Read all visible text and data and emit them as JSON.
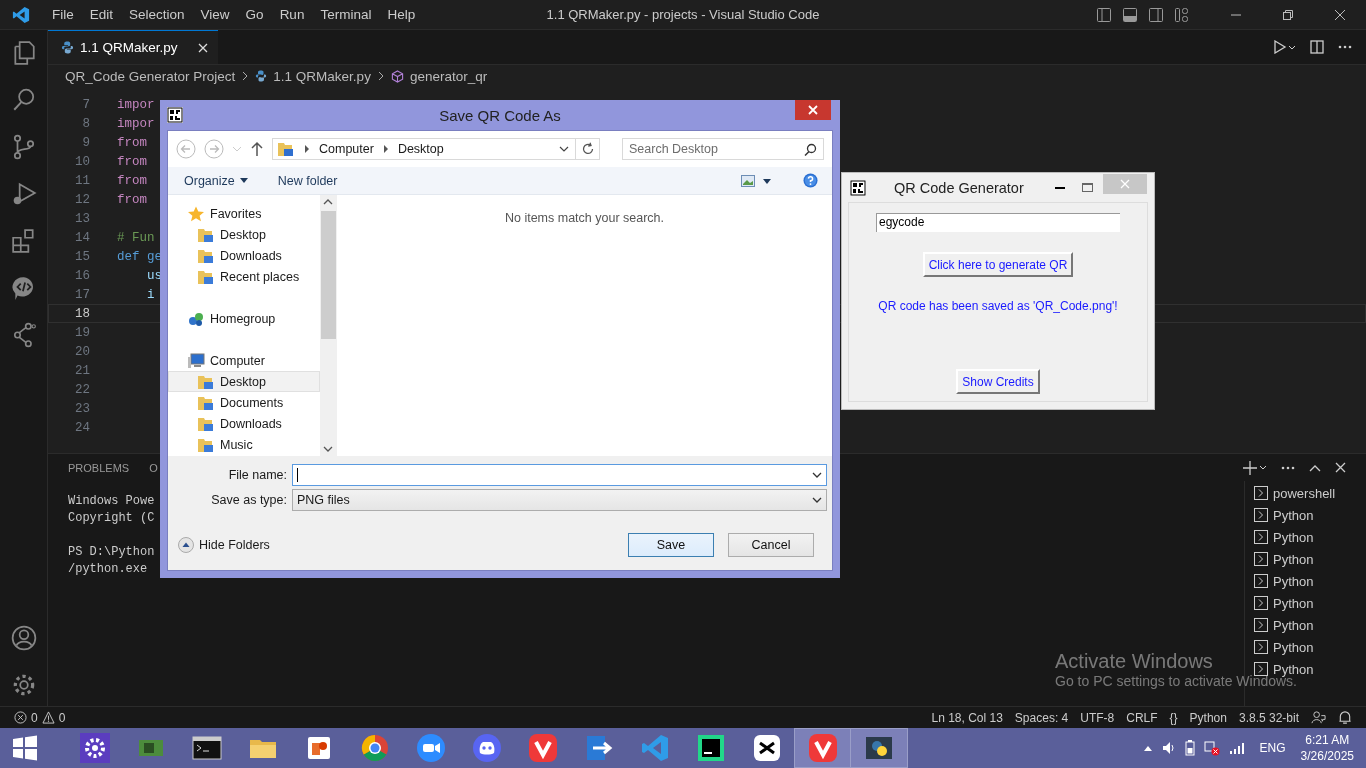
{
  "window": {
    "title": "1.1 QRMaker.py - projects - Visual Studio Code"
  },
  "menu": [
    "File",
    "Edit",
    "Selection",
    "View",
    "Go",
    "Run",
    "Terminal",
    "Help"
  ],
  "editor_tab": {
    "label": "1.1 QRMaker.py"
  },
  "breadcrumb": [
    "QR_Code Generator Project",
    "1.1 QRMaker.py",
    "generator_qr"
  ],
  "code_lines": [
    {
      "number": "7",
      "text": "impor",
      "kind": "keyword",
      "current": false
    },
    {
      "number": "8",
      "text": "impor",
      "kind": "keyword",
      "current": false
    },
    {
      "number": "9",
      "text": "from",
      "kind": "keyword",
      "current": false
    },
    {
      "number": "10",
      "text": "from",
      "kind": "keyword",
      "current": false
    },
    {
      "number": "11",
      "text": "from",
      "kind": "keyword",
      "current": false
    },
    {
      "number": "12",
      "text": "from",
      "kind": "keyword",
      "current": false
    },
    {
      "number": "13",
      "kind": "blank",
      "current": false
    },
    {
      "number": "14",
      "text": "# Fun",
      "kind": "comment",
      "current": false
    },
    {
      "number": "15",
      "text": "def ge",
      "kind": "def",
      "current": false
    },
    {
      "number": "16",
      "text": "    us",
      "kind": "name",
      "current": false
    },
    {
      "number": "17",
      "text": "    i",
      "kind": "name",
      "current": false
    },
    {
      "number": "18",
      "kind": "blank",
      "current": true
    },
    {
      "number": "19",
      "kind": "blank",
      "current": false
    },
    {
      "number": "20",
      "kind": "blank",
      "current": false
    },
    {
      "number": "21",
      "kind": "blank",
      "current": false
    },
    {
      "number": "22",
      "kind": "blank",
      "current": false
    },
    {
      "number": "23",
      "kind": "blank",
      "current": false
    },
    {
      "number": "24",
      "kind": "blank",
      "current": false
    }
  ],
  "panel": {
    "tabs": [
      "PROBLEMS",
      "O"
    ],
    "terminal_blocks": [
      [
        "Windows Powe",
        "Copyright (C"
      ],
      [
        "PS D:\\Python",
        "/python.exe"
      ]
    ],
    "terminals": [
      "powershell",
      "Python",
      "Python",
      "Python",
      "Python",
      "Python",
      "Python",
      "Python",
      "Python"
    ]
  },
  "activation": {
    "title": "Activate Windows",
    "subtitle": "Go to PC settings to activate Windows."
  },
  "status_bar": {
    "errors": "0",
    "warnings": "0",
    "items": [
      "Ln 18, Col 13",
      "Spaces: 4",
      "UTF-8",
      "CRLF",
      "{}",
      "Python",
      "3.8.5 32-bit"
    ]
  },
  "dialog": {
    "title": "Save QR Code As",
    "path": [
      "Computer",
      "Desktop"
    ],
    "search_placeholder": "Search Desktop",
    "toolbar": [
      "Organize",
      "New folder"
    ],
    "nav": [
      {
        "label": "Favorites",
        "kind": "group",
        "selected": false
      },
      {
        "label": "Desktop",
        "kind": "item",
        "selected": false
      },
      {
        "label": "Downloads",
        "kind": "item",
        "selected": false
      },
      {
        "label": "Recent places",
        "kind": "item",
        "selected": false
      },
      {
        "label": "Homegroup",
        "kind": "group",
        "selected": false
      },
      {
        "label": "Computer",
        "kind": "group",
        "selected": false
      },
      {
        "label": "Desktop",
        "kind": "item",
        "selected": true
      },
      {
        "label": "Documents",
        "kind": "item",
        "selected": false
      },
      {
        "label": "Downloads",
        "kind": "item",
        "selected": false
      },
      {
        "label": "Music",
        "kind": "item",
        "selected": false
      }
    ],
    "empty_message": "No items match your search.",
    "file_name_label": "File name:",
    "type_label": "Save as type:",
    "type_value": "PNG files",
    "hide_folders": "Hide Folders",
    "buttons": [
      {
        "label": "Save",
        "default": true
      },
      {
        "label": "Cancel",
        "default": false
      }
    ]
  },
  "app": {
    "title": "QR Code Generator",
    "input_value": "egycode",
    "generate_button": "Click here to generate QR",
    "message": "QR code has been saved as 'QR_Code.png'!",
    "credits_button": "Show Credits"
  },
  "taskbar": {
    "apps": [
      {
        "kind": "settings",
        "active": false
      },
      {
        "kind": "gpu",
        "active": false
      },
      {
        "kind": "terminal",
        "active": false
      },
      {
        "kind": "folder",
        "active": false
      },
      {
        "kind": "office",
        "active": false
      },
      {
        "kind": "chrome",
        "active": false
      },
      {
        "kind": "zoom",
        "active": false
      },
      {
        "kind": "discord",
        "active": false
      },
      {
        "kind": "vivaldi",
        "active": false
      },
      {
        "kind": "transfer",
        "active": false
      },
      {
        "kind": "vscode",
        "active": false
      },
      {
        "kind": "pycharm",
        "active": false
      },
      {
        "kind": "capcut",
        "active": false
      },
      {
        "kind": "vivaldi",
        "active": true
      },
      {
        "kind": "python",
        "active": true
      }
    ],
    "language": "ENG",
    "time": "6:21 AM",
    "date": "3/26/2025"
  }
}
